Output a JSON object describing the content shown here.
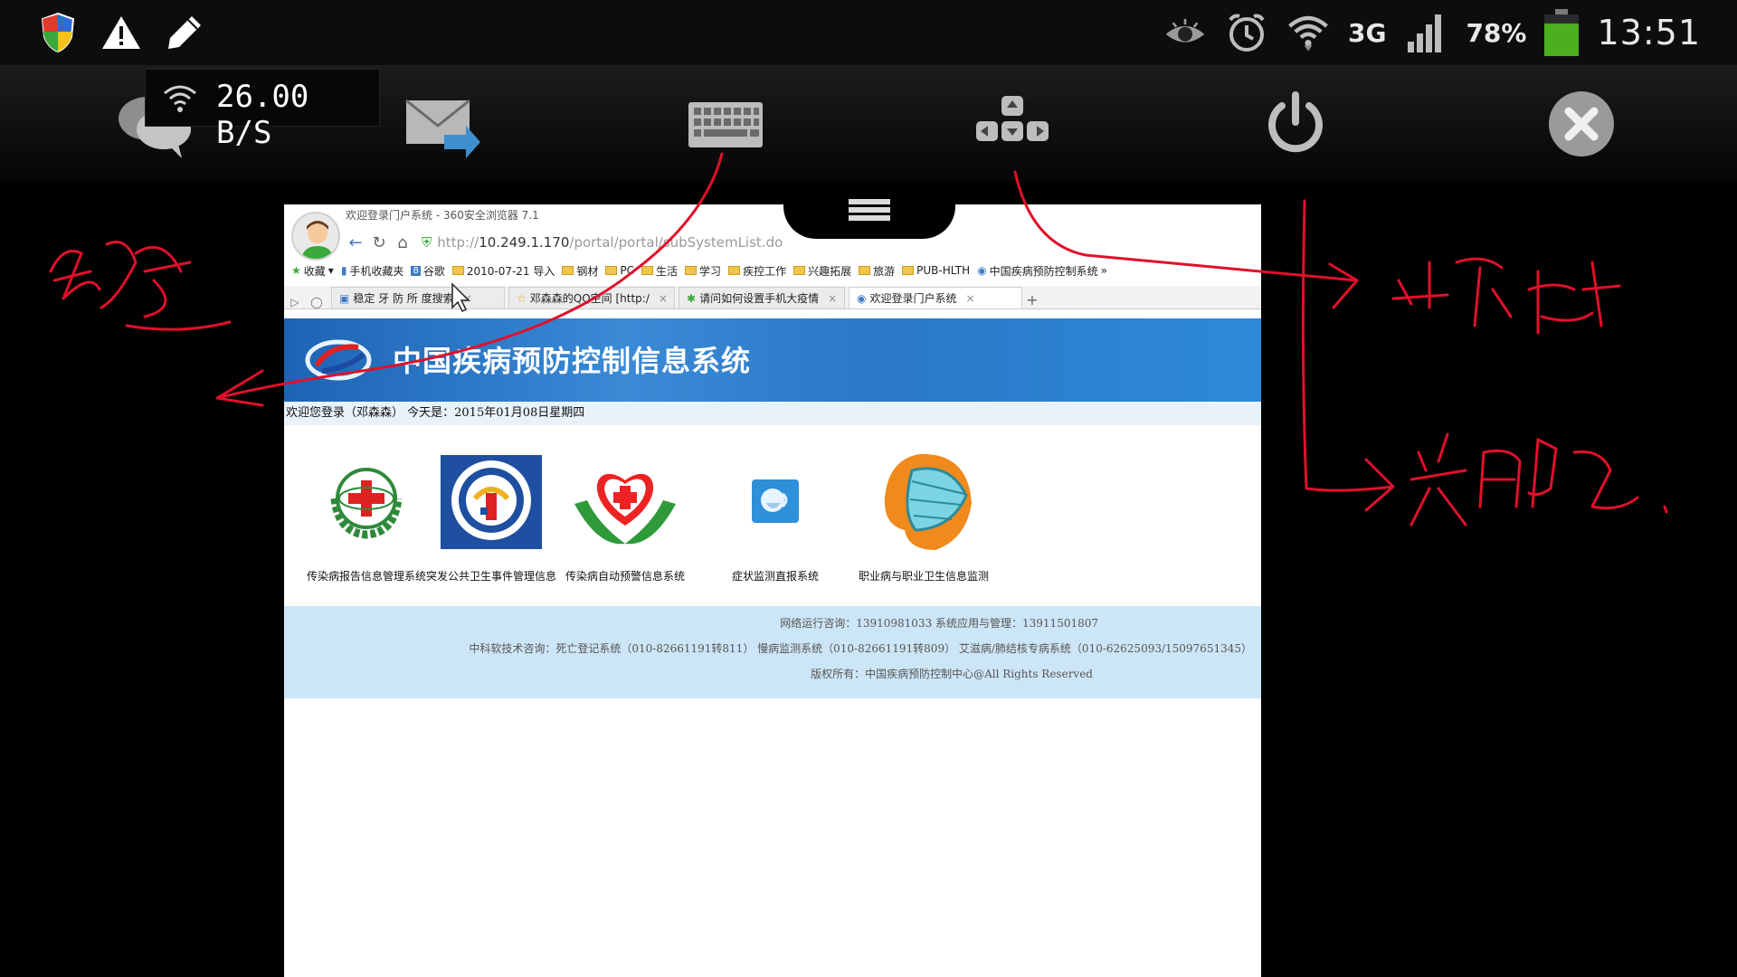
{
  "status_bar": {
    "icons_left": [
      "shield-icon",
      "warning-icon",
      "pencil-icon"
    ],
    "icons_right": [
      "eye-icon",
      "alarm-icon",
      "wifi-icon",
      "signal-icon"
    ],
    "network_type": "3G",
    "battery_percent": "78%",
    "battery_level": 0.78,
    "time": "13:51"
  },
  "toolbar": {
    "speed": "26.00 B/S",
    "buttons": [
      "chat-icon",
      "send-mail-icon",
      "keyboard-icon",
      "dpad-icon",
      "power-icon",
      "close-icon"
    ]
  },
  "browser": {
    "window_title": "欢迎登录门户系统 - 360安全浏览器 7.1",
    "url_prefix": "http://",
    "url_host": "10.249.1.170",
    "url_path": "/portal/portal/subSystemList.do",
    "bookmarks": [
      "收藏",
      "手机收藏夹",
      "谷歌",
      "2010-07-21 导入",
      "钢材",
      "PC",
      "生活",
      "学习",
      "疾控工作",
      "兴趣拓展",
      "旅游",
      "PUB-HLTH",
      "中国疾病预防控制系统"
    ],
    "tabs": [
      {
        "label": "稳定 牙 防 所 度搜索",
        "active": false
      },
      {
        "label": "邓森森的QQ空间 [http:/",
        "active": false
      },
      {
        "label": "请问如何设置手机大疫情",
        "active": false
      },
      {
        "label": "欢迎登录门户系统",
        "active": true
      }
    ],
    "new_tab": "+"
  },
  "page": {
    "banner_title": "中国疾病预防控制信息系统",
    "welcome": "欢迎您登录（邓森森）  今天是：2015年01月08日星期四",
    "systems": [
      {
        "label": "传染病报告信息管理系统"
      },
      {
        "label": "突发公共卫生事件管理信息"
      },
      {
        "label": "传染病自动预警信息系统"
      },
      {
        "label": "症状监测直报系统"
      },
      {
        "label": "职业病与职业卫生信息监测"
      }
    ],
    "footer_line1": "网络运行咨询：13910981033   系统应用与管理：13911501807",
    "footer_line2": "中科软技术咨询：死亡登记系统（010-82661191转811）   慢病监测系统（010-82661191转809）   艾滋病/肺结核专病系统（010-62625093/15097651345）",
    "footer_line3": "版权所有：中国疾病预防控制中心@All Rights Reserved"
  },
  "annotations": {
    "ink_color": "#e0102a"
  }
}
